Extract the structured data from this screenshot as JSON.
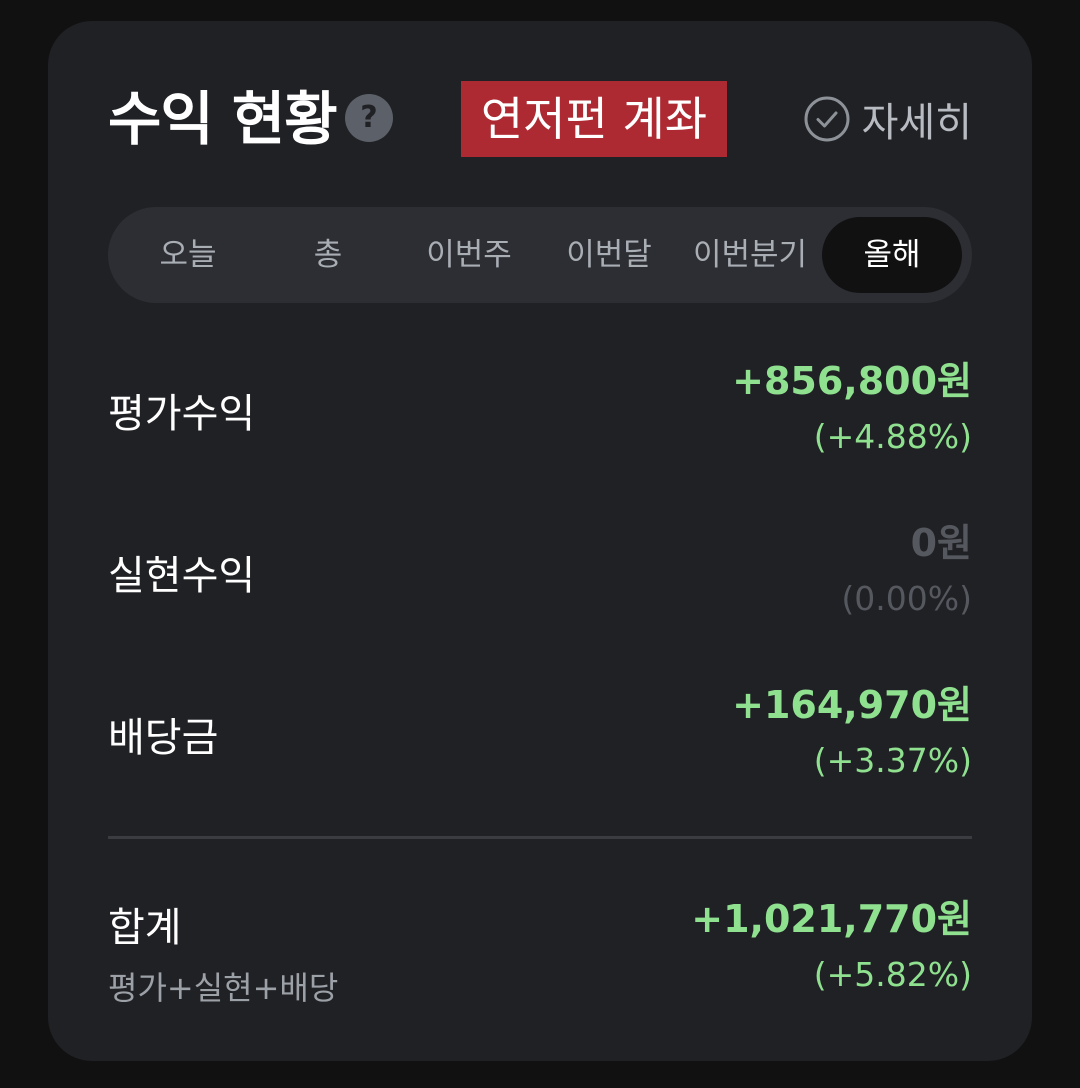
{
  "header": {
    "title": "수익 현황",
    "help_icon": "?",
    "account_tag": "연저펀 계좌",
    "detail_label": "자세히"
  },
  "tabs": [
    {
      "label": "오늘",
      "active": false
    },
    {
      "label": "총",
      "active": false
    },
    {
      "label": "이번주",
      "active": false
    },
    {
      "label": "이번달",
      "active": false
    },
    {
      "label": "이번분기",
      "active": false
    },
    {
      "label": "올해",
      "active": true
    }
  ],
  "rows": {
    "valuation": {
      "label": "평가수익",
      "amount": "+856,800원",
      "percent": "(+4.88%)"
    },
    "realized": {
      "label": "실현수익",
      "amount": "0원",
      "percent": "(0.00%)"
    },
    "dividend": {
      "label": "배당금",
      "amount": "+164,970원",
      "percent": "(+3.37%)"
    }
  },
  "total": {
    "label": "합계",
    "sub_label": "평가+실현+배당",
    "amount": "+1,021,770원",
    "percent": "(+5.82%)"
  },
  "colors": {
    "positive": "#8fe190",
    "neutral": "#55585e",
    "account_tag_bg": "#ad2a32",
    "card_bg": "#202125"
  },
  "icons": {
    "help": "question-circle-icon",
    "detail": "check-circle-icon"
  }
}
